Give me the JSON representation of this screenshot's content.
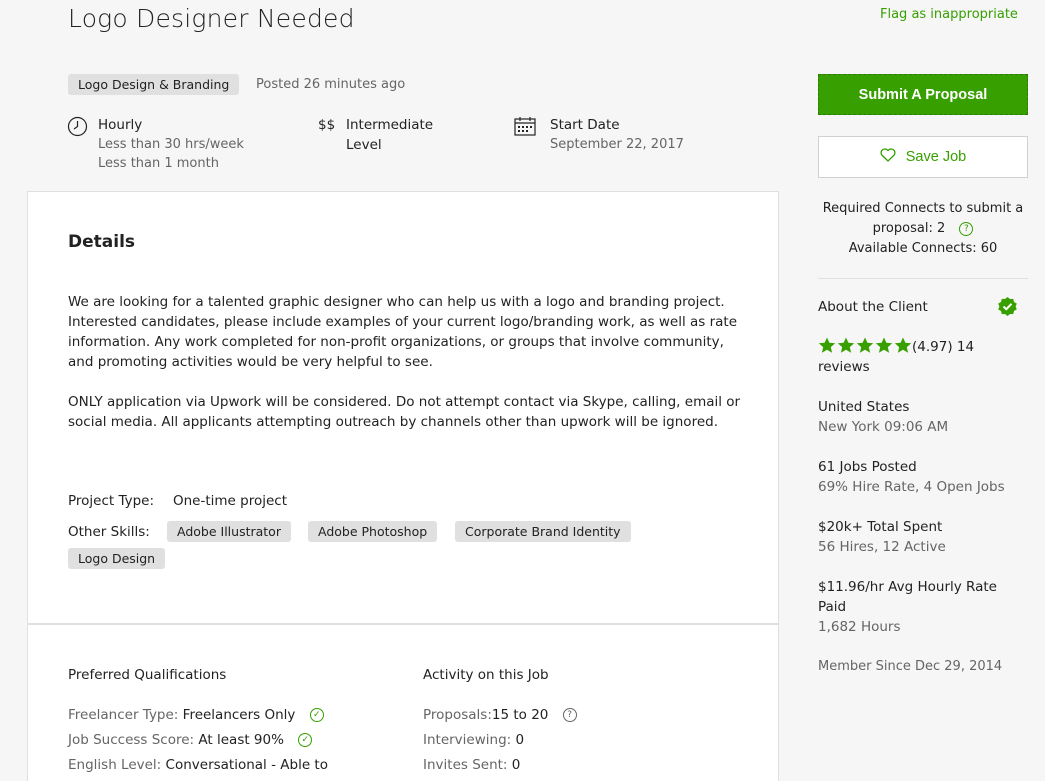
{
  "job": {
    "title": "Logo Designer Needed",
    "flag_label": "Flag as inappropriate",
    "category": "Logo Design & Branding",
    "posted": "Posted 26 minutes ago",
    "meta": {
      "hourly": {
        "label": "Hourly",
        "line1": "Less than 30 hrs/week",
        "line2": "Less than 1 month"
      },
      "level": {
        "symbol": "$$",
        "line1": "Intermediate",
        "line2": "Level"
      },
      "start": {
        "label": "Start Date",
        "date": "September 22, 2017"
      }
    }
  },
  "details": {
    "heading": "Details",
    "paragraph1": "We are looking for a talented graphic designer who can help us with a logo and branding project. Interested candidates, please include examples of your current logo/branding work, as well as rate information. Any work completed for non-profit organizations, or groups that involve community, and promoting activities would be very helpful to see.",
    "paragraph2": "ONLY application via Upwork will be considered. Do not attempt contact via Skype, calling, email or social media. All applicants attempting outreach by channels other than upwork will be ignored.",
    "project_type_label": "Project Type:",
    "project_type_value": "One-time project",
    "other_skills_label": "Other Skills:",
    "skills": [
      "Adobe Illustrator",
      "Adobe Photoshop",
      "Corporate Brand Identity",
      "Logo Design"
    ]
  },
  "qualifications": {
    "heading": "Preferred Qualifications",
    "freelancer_type_label": "Freelancer Type:",
    "freelancer_type_value": "Freelancers Only",
    "job_success_label": "Job Success Score:",
    "job_success_value": "At least 90%",
    "english_label": "English Level:",
    "english_value": "Conversational - Able to"
  },
  "activity": {
    "heading": "Activity on this Job",
    "proposals_label": "Proposals:",
    "proposals_value": "15 to 20",
    "interviewing_label": "Interviewing:",
    "interviewing_value": "0",
    "invites_label": "Invites Sent:",
    "invites_value": "0"
  },
  "sidebar": {
    "submit_label": "Submit A Proposal",
    "save_label": "Save Job",
    "connects_line1": "Required Connects to submit a",
    "connects_line2": "proposal: 2",
    "connects_line3": "Available Connects: 60",
    "about_client": "About the Client",
    "rating": "(4.97) 14",
    "rating_stars": 5,
    "reviews_word": "reviews",
    "country": "United States",
    "local_time": "New York 09:06 AM",
    "jobs_posted": "61 Jobs Posted",
    "hire_rate": "69% Hire Rate, 4 Open Jobs",
    "total_spent": "$20k+ Total Spent",
    "hires": "56 Hires, 12 Active",
    "avg_rate_line1": "$11.96/hr Avg Hourly Rate",
    "avg_rate_line2": "Paid",
    "hours": "1,682 Hours",
    "member_since": "Member Since Dec 29, 2014"
  },
  "colors": {
    "accent": "#37a000",
    "muted": "#656565",
    "tag_bg": "#e0e0e0",
    "star": "#37a000"
  },
  "icons": {
    "clock": "clock-icon",
    "calendar": "calendar-icon",
    "heart": "heart-icon",
    "verified": "verified-check-icon",
    "star": "star-icon",
    "help": "help-icon",
    "check": "check-circle-icon"
  }
}
